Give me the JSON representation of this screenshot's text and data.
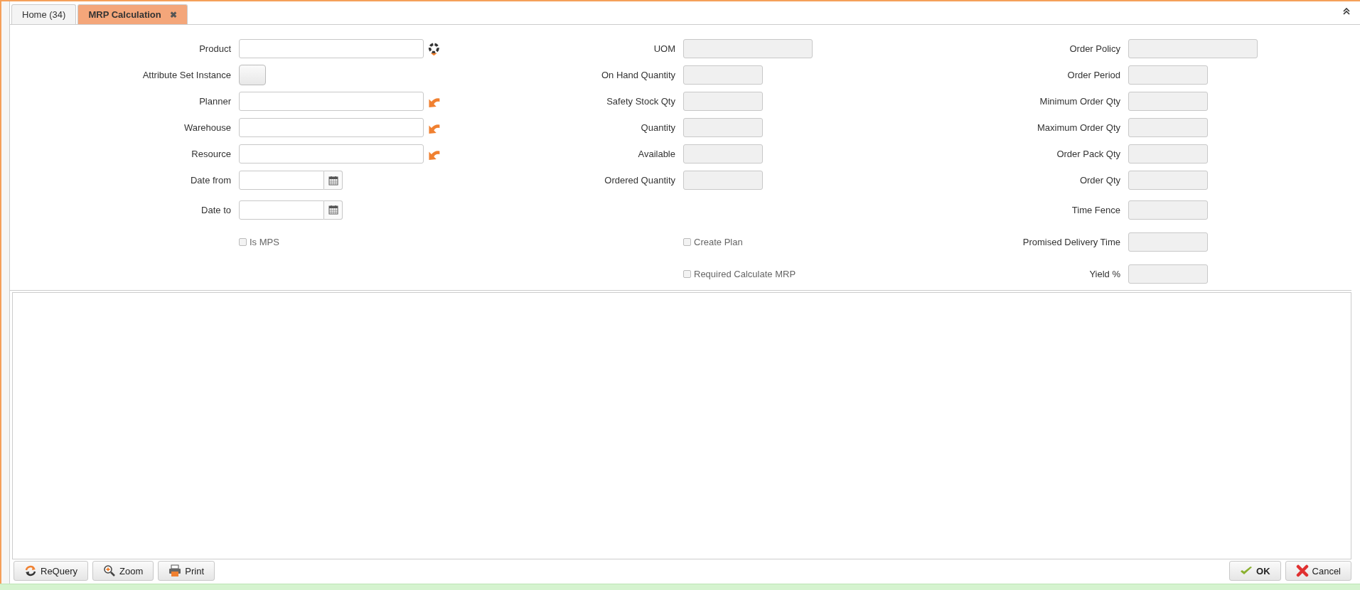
{
  "tabs": [
    {
      "label": "Home (34)",
      "selected": false,
      "closable": false
    },
    {
      "label": "MRP Calculation",
      "selected": true,
      "closable": true,
      "close_glyph": "✖"
    }
  ],
  "form": {
    "rows": [
      {
        "left": {
          "label": "Product",
          "kind": "product",
          "disabled": false
        },
        "middle": {
          "label": "UOM",
          "kind": "list",
          "disabled": true
        },
        "right": {
          "label": "Order Policy",
          "kind": "list",
          "disabled": true
        }
      },
      {
        "left": {
          "label": "Attribute Set Instance",
          "kind": "attribute",
          "disabled": false
        },
        "middle": {
          "label": "On Hand Quantity",
          "kind": "number",
          "disabled": true
        },
        "right": {
          "label": "Order Period",
          "kind": "number",
          "disabled": true
        }
      },
      {
        "left": {
          "label": "Planner",
          "kind": "search",
          "disabled": false
        },
        "middle": {
          "label": "Safety Stock Qty",
          "kind": "number",
          "disabled": true
        },
        "right": {
          "label": "Minimum Order Qty",
          "kind": "number",
          "disabled": true
        }
      },
      {
        "left": {
          "label": "Warehouse",
          "kind": "search",
          "disabled": false
        },
        "middle": {
          "label": "Quantity",
          "kind": "number",
          "disabled": true
        },
        "right": {
          "label": "Maximum Order Qty",
          "kind": "number",
          "disabled": true
        }
      },
      {
        "left": {
          "label": "Resource",
          "kind": "search",
          "disabled": false
        },
        "middle": {
          "label": "Available",
          "kind": "number",
          "disabled": true
        },
        "right": {
          "label": "Order Pack Qty",
          "kind": "number",
          "disabled": true
        }
      },
      {
        "left": {
          "label": "Date from",
          "kind": "date",
          "disabled": false
        },
        "middle": {
          "label": "Ordered Quantity",
          "kind": "number",
          "disabled": true
        },
        "right": {
          "label": "Order Qty",
          "kind": "number",
          "disabled": true
        }
      },
      {
        "left": {
          "label": "Date to",
          "kind": "date",
          "disabled": false
        },
        "right": {
          "label": "Time Fence",
          "kind": "number",
          "disabled": true
        }
      },
      {
        "left": {
          "label": "Is MPS",
          "kind": "checkbox",
          "checked": false,
          "disabled": true
        },
        "middle": {
          "label": "Create Plan",
          "kind": "checkbox",
          "checked": false,
          "disabled": true
        },
        "right": {
          "label": "Promised Delivery Time",
          "kind": "number",
          "disabled": true
        }
      },
      {
        "middle": {
          "label": "Required Calculate MRP",
          "kind": "checkbox",
          "checked": false,
          "disabled": true
        },
        "right": {
          "label": "Yield %",
          "kind": "number",
          "disabled": true
        }
      }
    ]
  },
  "buttons_left": [
    {
      "label": "ReQuery",
      "kind": "requery"
    },
    {
      "label": "Zoom",
      "kind": "zoom"
    },
    {
      "label": "Print",
      "kind": "print"
    }
  ],
  "buttons_right": [
    {
      "label": "OK",
      "kind": "ok"
    },
    {
      "label": "Cancel",
      "kind": "cancel"
    }
  ]
}
